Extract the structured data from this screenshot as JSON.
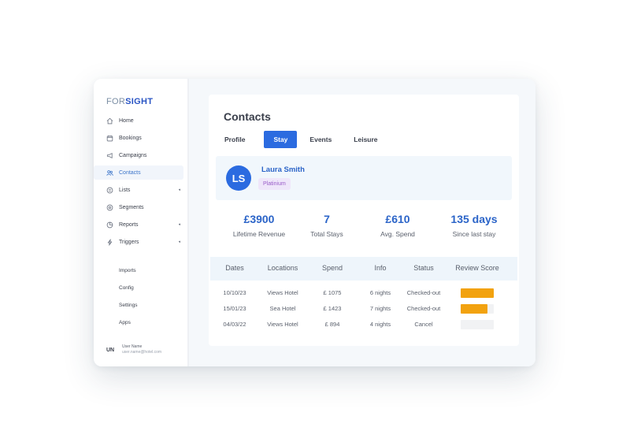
{
  "brand": {
    "part1": "FOR",
    "part2": "SIGHT"
  },
  "sidebar": {
    "items": [
      {
        "label": "Home",
        "icon": "home-icon"
      },
      {
        "label": "Bookings",
        "icon": "calendar-icon"
      },
      {
        "label": "Campaigns",
        "icon": "megaphone-icon"
      },
      {
        "label": "Contacts",
        "icon": "users-icon",
        "active": true
      },
      {
        "label": "Lists",
        "icon": "list-icon",
        "caret": true
      },
      {
        "label": "Segments",
        "icon": "segments-icon"
      },
      {
        "label": "Reports",
        "icon": "reports-icon",
        "caret": true
      },
      {
        "label": "Triggers",
        "icon": "bolt-icon",
        "caret": true
      }
    ],
    "sub_items": [
      "Imports",
      "Config",
      "Settings",
      "Apps"
    ],
    "user": {
      "initials": "UN",
      "name": "User Name",
      "email": "user.name@hotel.com"
    }
  },
  "page": {
    "title": "Contacts",
    "tabs": [
      "Profile",
      "Stay",
      "Events",
      "Leisure"
    ],
    "active_tab": "Stay"
  },
  "contact": {
    "initials": "LS",
    "name": "Laura Smith",
    "tier": "Platinium"
  },
  "stats": [
    {
      "value": "£3900",
      "label": "Lifetime Revenue"
    },
    {
      "value": "7",
      "label": "Total Stays"
    },
    {
      "value": "£610",
      "label": "Avg. Spend"
    },
    {
      "value": "135 days",
      "label": "Since last stay"
    }
  ],
  "table": {
    "headers": [
      "Dates",
      "Locations",
      "Spend",
      "Info",
      "Status",
      "Review Score"
    ],
    "rows": [
      {
        "date": "10/10/23",
        "location": "Views Hotel",
        "spend": "£ 1075",
        "info": "6 nights",
        "status": "Checked-out",
        "review_score": 1.0
      },
      {
        "date": "15/01/23",
        "location": "Sea Hotel",
        "spend": "£ 1423",
        "info": "7 nights",
        "status": "Checked-out",
        "review_score": 0.8
      },
      {
        "date": "04/03/22",
        "location": "Views Hotel",
        "spend": "£ 894",
        "info": "4 nights",
        "status": "Cancel",
        "review_score": 0.0
      }
    ]
  },
  "colors": {
    "accent": "#2b6be0",
    "score_bar": "#f2a20f",
    "tier_text": "#9a5cc8"
  }
}
